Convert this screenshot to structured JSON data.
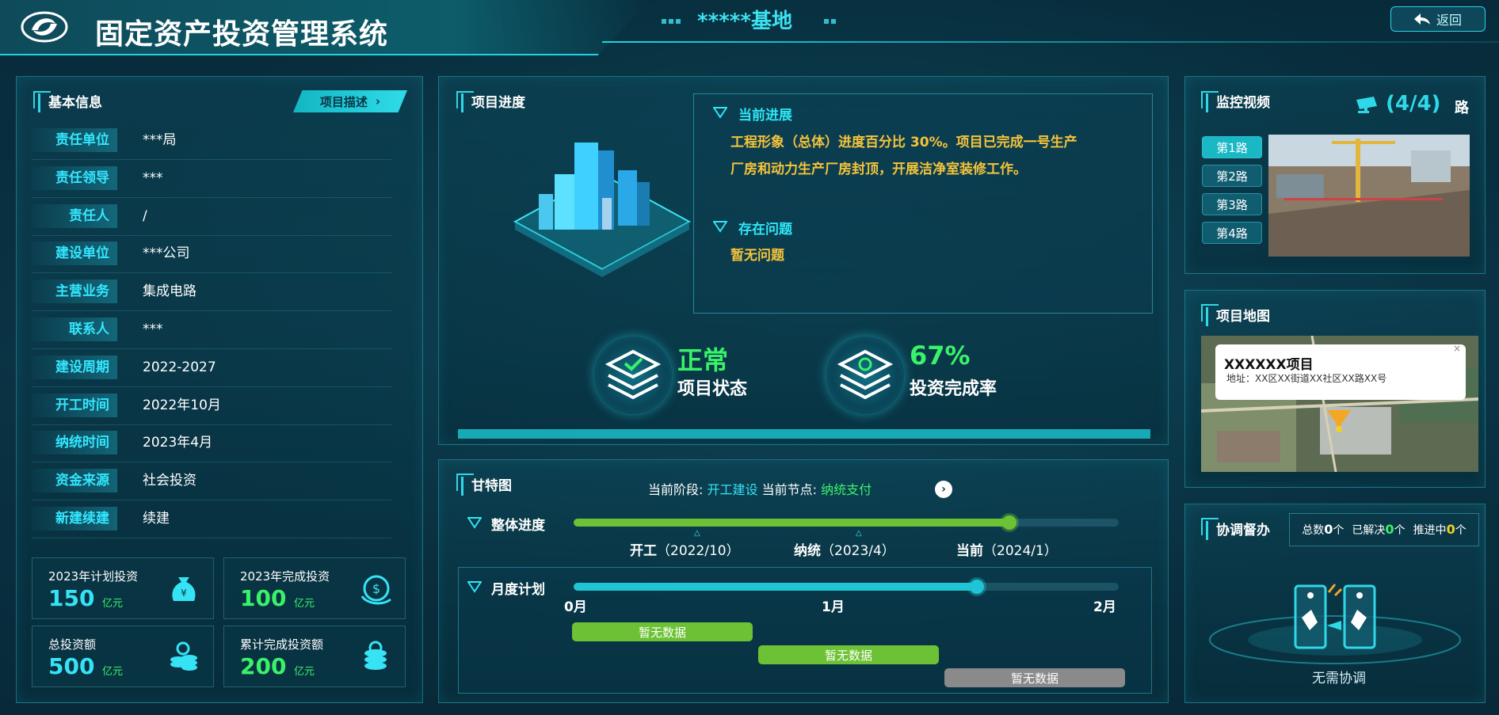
{
  "header": {
    "system_title": "固定资产投资管理系统",
    "base_name": "*****基地",
    "back_label": "返回"
  },
  "basic_info": {
    "title": "基本信息",
    "desc_button": "项目描述",
    "rows": [
      {
        "label": "责任单位",
        "value": "***局"
      },
      {
        "label": "责任领导",
        "value": "***"
      },
      {
        "label": "责任人",
        "value": "/"
      },
      {
        "label": "建设单位",
        "value": "***公司"
      },
      {
        "label": "主营业务",
        "value": "集成电路"
      },
      {
        "label": "联系人",
        "value": "***"
      },
      {
        "label": "建设周期",
        "value": "2022-2027"
      },
      {
        "label": "开工时间",
        "value": "2022年10月"
      },
      {
        "label": "纳统时间",
        "value": "2023年4月"
      },
      {
        "label": "资金来源",
        "value": "社会投资"
      },
      {
        "label": "新建续建",
        "value": "续建"
      }
    ],
    "investments": [
      {
        "label": "2023年计划投资",
        "value": "150",
        "unit": "亿元"
      },
      {
        "label": "2023年完成投资",
        "value": "100",
        "unit": "亿元"
      },
      {
        "label": "总投资额",
        "value": "500",
        "unit": "亿元"
      },
      {
        "label": "累计完成投资额",
        "value": "200",
        "unit": "亿元"
      }
    ]
  },
  "progress": {
    "title": "项目进度",
    "current_head": "当前进展",
    "current_text_1": "工程形象（总体）进度百分比 30%。项目已完成一号生产",
    "current_text_2": "厂房和动力生产厂房封顶，开展洁净室装修工作。",
    "issue_head": "存在问题",
    "issue_text": "暂无问题",
    "status_value": "正常",
    "status_label": "项目状态",
    "rate_value": "67%",
    "rate_label": "投资完成率"
  },
  "gantt": {
    "title": "甘特图",
    "stage_label": "当前阶段:",
    "stage_value": "开工建设",
    "node_label": "当前节点:",
    "node_value": "纳统支付",
    "overall_label": "整体进度",
    "overall_progress": 0.8,
    "milestones": [
      {
        "name": "开工",
        "date": "（2022/10）"
      },
      {
        "name": "纳统",
        "date": "（2023/4）"
      },
      {
        "name": "当前",
        "date": "（2024/1）"
      }
    ],
    "monthly_label": "月度计划",
    "monthly_progress": 0.74,
    "months": [
      "0月",
      "1月",
      "2月"
    ],
    "no_data": [
      "暂无数据",
      "暂无数据",
      "暂无数据"
    ]
  },
  "monitor": {
    "title": "监控视频",
    "count": "(4/4)",
    "unit": "路",
    "channels": [
      "第1路",
      "第2路",
      "第3路",
      "第4路"
    ]
  },
  "map": {
    "title": "项目地图",
    "popup_title": "XXXXXX项目",
    "popup_address": "地址：XX区XX街道XX社区XX路XX号"
  },
  "coord": {
    "title": "协调督办",
    "total_label": "总数",
    "total_value": "0",
    "total_unit": "个",
    "solved_label": "已解决",
    "solved_value": "0",
    "solved_unit": "个",
    "pending_label": "推进中",
    "pending_value": "0",
    "pending_unit": "个",
    "status": "无需协调"
  }
}
